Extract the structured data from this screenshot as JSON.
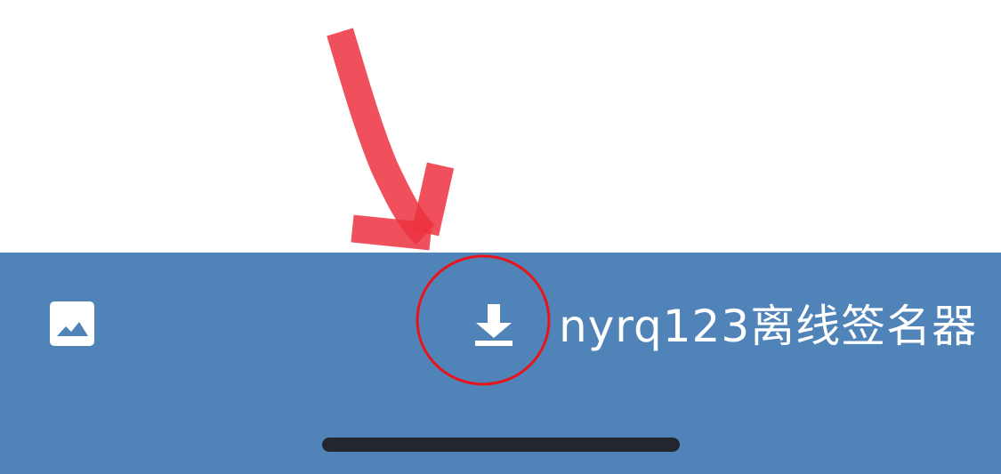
{
  "toolbar": {
    "title": "nyrq123离线签名器"
  },
  "icons": {
    "image": "image-icon",
    "download": "download-icon"
  },
  "colors": {
    "toolbar_background": "#5083b8",
    "icon_color": "#ffffff",
    "annotation_red": "#e8141c"
  }
}
